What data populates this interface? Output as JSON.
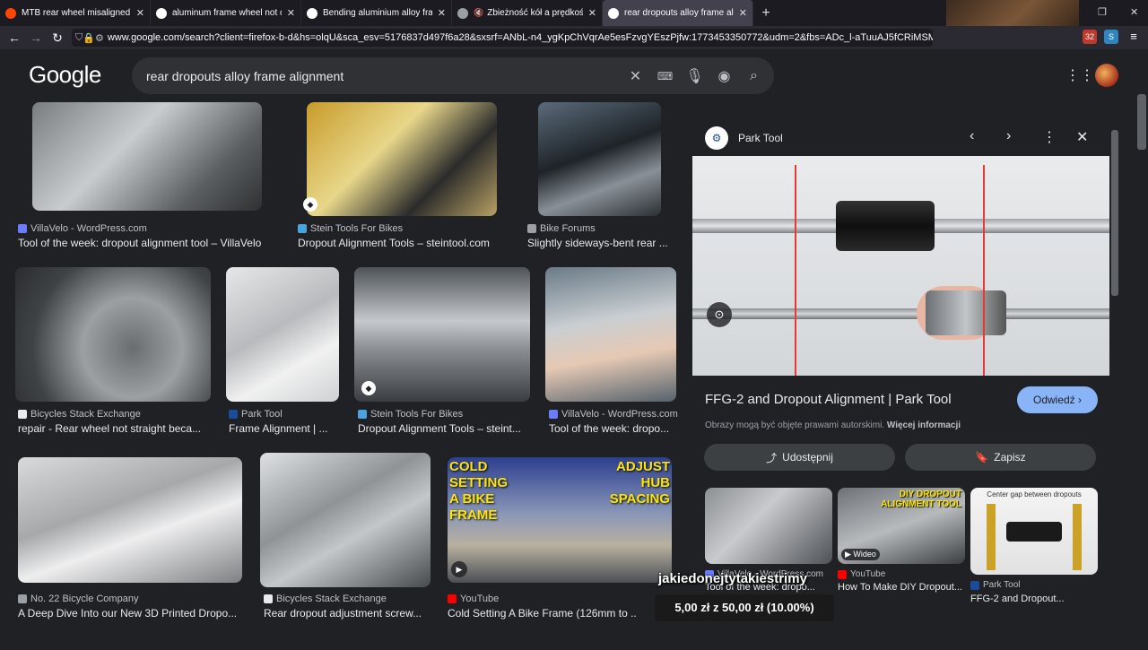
{
  "tabs": [
    {
      "label": "MTB rear wheel misaligned - ho",
      "color": "#ff4500"
    },
    {
      "label": "aluminum frame wheel not cent",
      "color": "#4285f4"
    },
    {
      "label": "Bending aluminium alloy frame",
      "color": "#4285f4"
    },
    {
      "label": "Zbieżność kół a prędkość",
      "color": "#9aa0a6"
    },
    {
      "label": "rear dropouts alloy frame align",
      "color": "#4285f4"
    }
  ],
  "new_tab": "+",
  "url": "www.google.com/search?client=firefox-b-d&hs=olqU&sca_esv=5176837d497f6a28&sxsrf=ANbL-n4_ygKpChVqrAe5esFzvgYEszPjfw:1773453350772&udm=2&fbs=ADc_l-aTuuAJ5fCRiMSMSikFOrC",
  "extension_badge": "32",
  "google": {
    "logo": "Google",
    "query": "rear dropouts alloy frame alignment"
  },
  "results": [
    {
      "source": "VillaVelo - WordPress.com",
      "title": "Tool of the week: dropout alignment tool – VillaVelo",
      "fav": "#6b7cff"
    },
    {
      "source": "Stein Tools For Bikes",
      "title": "Dropout Alignment Tools – steintool.com",
      "fav": "#4aa3df"
    },
    {
      "source": "Bike Forums",
      "title": "Slightly sideways-bent rear ...",
      "fav": "#9aa0a6"
    },
    {
      "source": "Bicycles Stack Exchange",
      "title": "repair - Rear wheel not straight beca...",
      "fav": "#e8eaed"
    },
    {
      "source": "Park Tool",
      "title": "Frame Alignment | ...",
      "fav": "#1b4b9b"
    },
    {
      "source": "Stein Tools For Bikes",
      "title": "Dropout Alignment Tools – steint...",
      "fav": "#4aa3df"
    },
    {
      "source": "VillaVelo - WordPress.com",
      "title": "Tool of the week: dropo...",
      "fav": "#6b7cff"
    },
    {
      "source": "No. 22 Bicycle Company",
      "title": "A Deep Dive Into our New 3D Printed Dropo...",
      "fav": "#9aa0a6"
    },
    {
      "source": "Bicycles Stack Exchange",
      "title": "Rear dropout adjustment screw...",
      "fav": "#e8eaed"
    },
    {
      "source": "YouTube",
      "title": "Cold Setting A Bike Frame (126mm to ...",
      "fav": "#ff0000"
    }
  ],
  "thumb_texts": {
    "cold_setting": "COLD SETTING A BIKE FRAME",
    "adjust_hub": "ADJUST HUB SPACING"
  },
  "panel": {
    "source": "Park Tool",
    "title": "FFG-2 and Dropout Alignment | Park Tool",
    "visit_label": "Odwiedź",
    "copyright": "Obrazy mogą być objęte prawami autorskimi.",
    "more_info": "Więcej informacji",
    "share_label": "Udostępnij",
    "save_label": "Zapisz",
    "related": [
      {
        "source": "VillaVelo - WordPress.com",
        "title": "Tool of the week: dropo..."
      },
      {
        "source": "YouTube",
        "title": "How To Make DIY Dropout..."
      },
      {
        "source": "Park Tool",
        "title": "FFG-2 and Dropout..."
      }
    ],
    "related_video_label": "Wideo",
    "related_img_text": "DIY DROPOUT ALIGNMENT TOOL",
    "related_img3_text": "Center gap between dropouts"
  },
  "overlay": {
    "text": "jakiedonejtytakiestrimy",
    "donation": "5,00 zł z 50,00 zł (10.00%)"
  }
}
